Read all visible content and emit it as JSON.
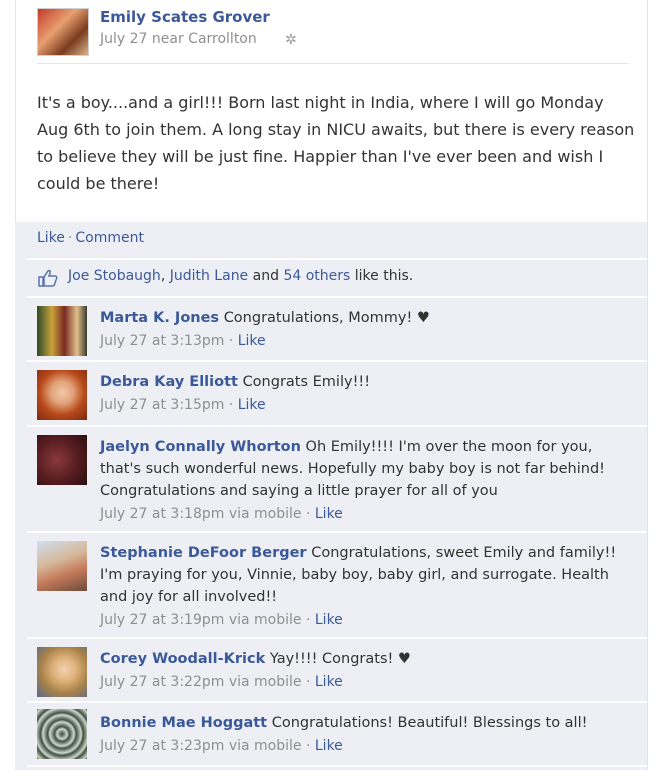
{
  "post": {
    "author": "Emily Scates Grover",
    "meta": "July 27 near Carrollton",
    "text": "It's a boy....and a girl!!! Born last night in India, where I will go Monday Aug 6th to join them. A long stay in NICU awaits, but there is every reason to believe they will be just fine. Happier than I've ever been and wish I could be there!",
    "settings_icon": "gear-icon"
  },
  "actions": {
    "like": "Like",
    "separator": "·",
    "comment": "Comment"
  },
  "likes": {
    "icon": "thumbs-up-icon",
    "person1": "Joe Stobaugh",
    "comma": ",",
    "person2": "Judith Lane",
    "and": "and",
    "others": "54 others",
    "suffix": "like this."
  },
  "comments": [
    {
      "name": "Marta K. Jones",
      "text": "Congratulations, Mommy! ♥",
      "time": "July 27 at 3:13pm",
      "via": "",
      "like": "Like"
    },
    {
      "name": "Debra Kay Elliott",
      "text": "Congrats Emily!!!",
      "time": "July 27 at 3:15pm",
      "via": "",
      "like": "Like"
    },
    {
      "name": "Jaelyn Connally Whorton",
      "text": "Oh Emily!!!! I'm over the moon for you, that's such wonderful news. Hopefully my baby boy is not far behind! Congratulations and saying a little prayer for all of you",
      "time": "July 27 at 3:18pm",
      "via": "via mobile",
      "like": "Like"
    },
    {
      "name": "Stephanie DeFoor Berger",
      "text": "Congratulations, sweet Emily and family!! I'm praying for you, Vinnie, baby boy, baby girl, and surrogate. Health and joy for all involved!!",
      "time": "July 27 at 3:19pm",
      "via": "via mobile",
      "like": "Like"
    },
    {
      "name": "Corey Woodall-Krick",
      "text": "Yay!!!! Congrats! ♥",
      "time": "July 27 at 3:22pm",
      "via": "via mobile",
      "like": "Like"
    },
    {
      "name": "Bonnie Mae Hoggatt",
      "text": "Congratulations! Beautiful! Blessings to all!",
      "time": "July 27 at 3:23pm",
      "via": "via mobile",
      "like": "Like"
    }
  ],
  "colors": {
    "link": "#3b5998",
    "meta": "#8f8f8f",
    "feedback_bg": "#edeff4"
  }
}
